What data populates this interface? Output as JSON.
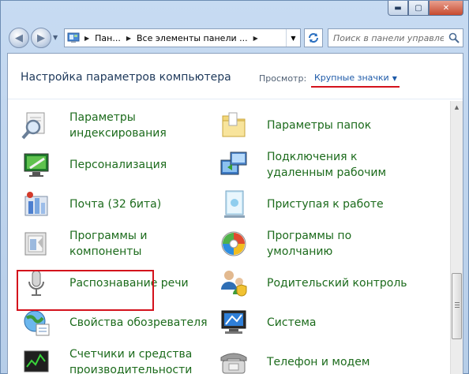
{
  "window": {
    "buttons": {
      "minimize": "▬",
      "maximize": "▢",
      "close": "✕"
    }
  },
  "address": {
    "crumbs": [
      "Пан...",
      "Все элементы панели ..."
    ]
  },
  "search": {
    "placeholder": "Поиск в панели управле..."
  },
  "header": {
    "title": "Настройка параметров компьютера",
    "view_label": "Просмотр:",
    "view_value": "Крупные значки"
  },
  "items": [
    {
      "label": "Параметры\nиндексирования",
      "icon": "indexing-icon"
    },
    {
      "label": "Параметры папок",
      "icon": "folder-options-icon"
    },
    {
      "label": "Персонализация",
      "icon": "personalization-icon"
    },
    {
      "label": "Подключения к\nудаленным рабочим",
      "icon": "remote-connection-icon"
    },
    {
      "label": "Почта (32 бита)",
      "icon": "mail-icon"
    },
    {
      "label": "Приступая к работе",
      "icon": "getting-started-icon"
    },
    {
      "label": "Программы и\nкомпоненты",
      "icon": "programs-features-icon"
    },
    {
      "label": "Программы по\nумолчанию",
      "icon": "default-programs-icon"
    },
    {
      "label": "Распознавание речи",
      "icon": "microphone-icon"
    },
    {
      "label": "Родительский контроль",
      "icon": "parental-control-icon"
    },
    {
      "label": "Свойства обозревателя",
      "icon": "internet-options-icon"
    },
    {
      "label": "Система",
      "icon": "system-icon"
    },
    {
      "label": "Счетчики и средства\nпроизводительности",
      "icon": "performance-icon"
    },
    {
      "label": "Телефон и модем",
      "icon": "phone-modem-icon"
    }
  ],
  "colors": {
    "link_green": "#1c6b1c",
    "title_blue": "#1e395b",
    "highlight_red": "#d4121c"
  }
}
